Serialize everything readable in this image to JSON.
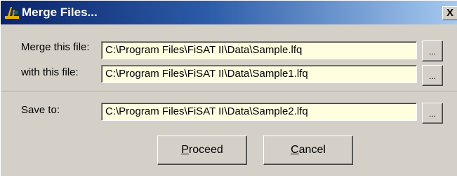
{
  "window": {
    "title": "Merge Files...",
    "close_label": "X"
  },
  "fields": [
    {
      "label": "Merge this file:",
      "value": "C:\\Program Files\\FiSAT II\\Data\\Sample.lfq",
      "browse_label": "..."
    },
    {
      "label": "with this file:",
      "value": "C:\\Program Files\\FiSAT II\\Data\\Sample1.lfq",
      "browse_label": "..."
    },
    {
      "label": "Save to:",
      "value": "C:\\Program Files\\FiSAT II\\Data\\Sample2.lfq",
      "browse_label": "..."
    }
  ],
  "buttons": {
    "proceed": {
      "accel": "P",
      "rest": "roceed"
    },
    "cancel": {
      "accel": "C",
      "rest": "ancel"
    }
  }
}
